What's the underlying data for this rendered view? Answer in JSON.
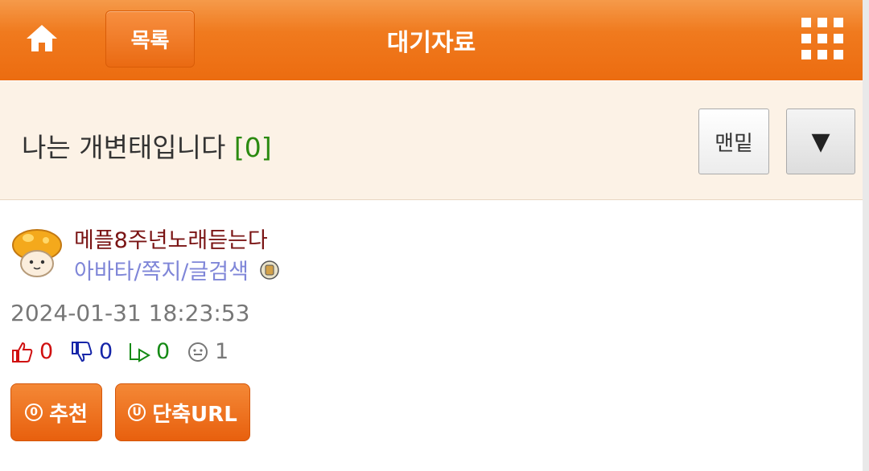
{
  "header": {
    "list_label": "목록",
    "title": "대기자료"
  },
  "post": {
    "title": "나는 개변태입니다",
    "comment_count": "[0]",
    "bottom_label": "맨밑",
    "down_label": "▼"
  },
  "author": {
    "name": "메플8주년노래듣는다",
    "links": "아바타/쪽지/글검색"
  },
  "meta": {
    "date": "2024-01-31 18:23:53",
    "likes": "0",
    "dislikes": "0",
    "shares": "0",
    "views": "1"
  },
  "actions": {
    "recommend_icon": "0",
    "recommend_label": "추천",
    "shorturl_icon": "U",
    "shorturl_label": "단축URL"
  },
  "colors": {
    "accent": "#f07a1e",
    "title_bg": "#fcf2e6",
    "author": "#7a1414",
    "links": "#7f86d8",
    "count_green": "#2b8a10"
  },
  "icons": [
    "home-icon",
    "grid-menu-icon",
    "mushroom-avatar",
    "badge-icon",
    "thumbs-up-icon",
    "thumbs-down-icon",
    "share-icon",
    "smiley-icon"
  ]
}
